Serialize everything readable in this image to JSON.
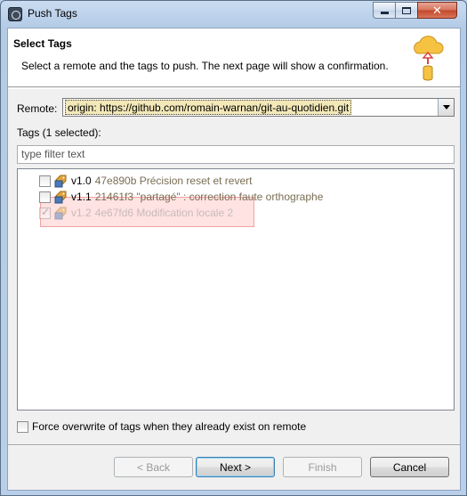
{
  "window": {
    "title": "Push Tags"
  },
  "header": {
    "title": "Select Tags",
    "description": "Select a remote and the tags to push. The next page will show a confirmation."
  },
  "remote": {
    "label": "Remote:",
    "value": "origin: https://github.com/romain-warnan/git-au-quotidien.git"
  },
  "tags": {
    "label": "Tags (1 selected):",
    "filter_placeholder": "type filter text",
    "items": [
      {
        "name": "v1.0",
        "commit": "47e890b Précision reset et revert",
        "checked": false
      },
      {
        "name": "v1.1",
        "commit": "21461f3 \"partagé\" : correction faute orthographe",
        "checked": false
      },
      {
        "name": "v1.2",
        "commit": "4e67fd6 Modification locale 2",
        "checked": true
      }
    ]
  },
  "force_overwrite": {
    "label": "Force overwrite of tags when they already exist on remote",
    "checked": false
  },
  "buttons": {
    "back": "< Back",
    "next": "Next >",
    "finish": "Finish",
    "cancel": "Cancel"
  },
  "colors": {
    "highlight": "#ff9696",
    "tag_icon": "#e2a33a",
    "cloud": "#f5c242"
  }
}
